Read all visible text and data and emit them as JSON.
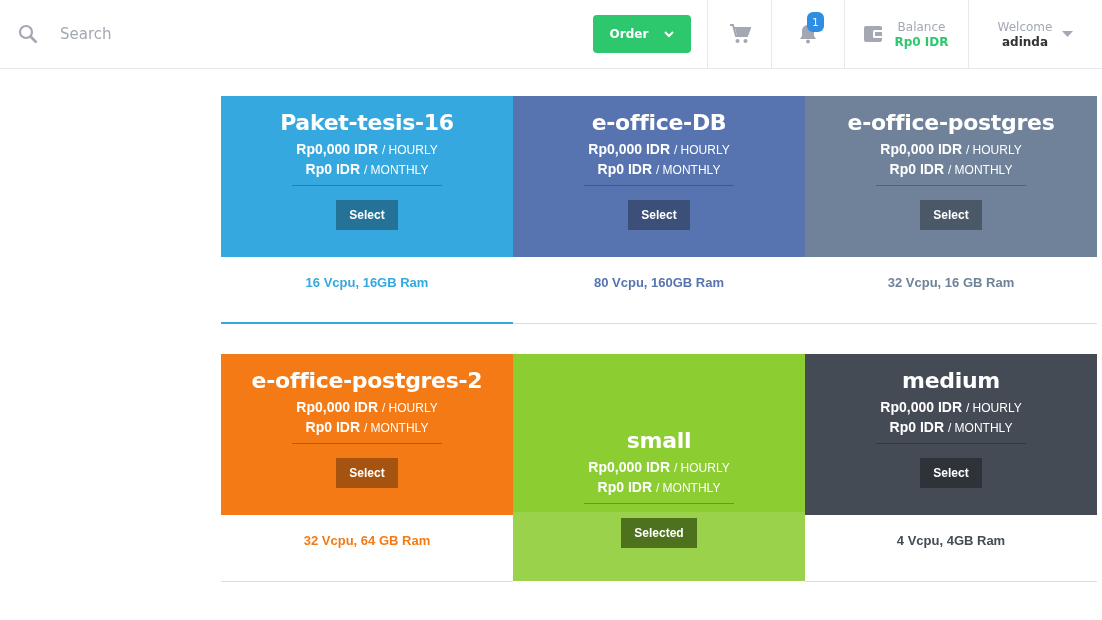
{
  "header": {
    "search": {
      "placeholder": "Search"
    },
    "order_button": "Order",
    "notifications": {
      "badge": "1"
    },
    "balance": {
      "label": "Balance",
      "value": "Rp0 IDR"
    },
    "user": {
      "label": "Welcome",
      "name": "adinda"
    }
  },
  "plans": [
    {
      "name": "Paket-tesis-16",
      "hourly": "Rp0,000 IDR",
      "hourly_unit": "/ HOURLY",
      "monthly": "Rp0 IDR",
      "monthly_unit": "/ MONTHLY",
      "button": "Select",
      "spec": "16 Vcpu, 16GB Ram",
      "color": "#35a8df",
      "selected": false,
      "highlighted": true
    },
    {
      "name": "e-office-DB",
      "hourly": "Rp0,000 IDR",
      "hourly_unit": "/ HOURLY",
      "monthly": "Rp0 IDR",
      "monthly_unit": "/ MONTHLY",
      "button": "Select",
      "spec": "80 Vcpu, 160GB Ram",
      "color": "#5774b0",
      "selected": false,
      "highlighted": false
    },
    {
      "name": "e-office-postgres",
      "hourly": "Rp0,000 IDR",
      "hourly_unit": "/ HOURLY",
      "monthly": "Rp0 IDR",
      "monthly_unit": "/ MONTHLY",
      "button": "Select",
      "spec": "32 Vcpu, 16 GB Ram",
      "color": "#6f8299",
      "selected": false,
      "highlighted": false
    },
    {
      "name": "e-office-postgres-2",
      "hourly": "Rp0,000 IDR",
      "hourly_unit": "/ HOURLY",
      "monthly": "Rp0 IDR",
      "monthly_unit": "/ MONTHLY",
      "button": "Select",
      "spec": "32 Vcpu, 64 GB Ram",
      "color": "#f37a14",
      "selected": false,
      "highlighted": false
    },
    {
      "name": "small",
      "hourly": "Rp0,000 IDR",
      "hourly_unit": "/ HOURLY",
      "monthly": "Rp0 IDR",
      "monthly_unit": "/ MONTHLY",
      "button": "Selected",
      "color": "#8ccd32",
      "selected": true,
      "highlighted": false
    },
    {
      "name": "medium",
      "hourly": "Rp0,000 IDR",
      "hourly_unit": "/ HOURLY",
      "monthly": "Rp0 IDR",
      "monthly_unit": "/ MONTHLY",
      "button": "Select",
      "spec": "4 Vcpu, 4GB Ram",
      "color": "#444b55",
      "selected": false,
      "highlighted": false
    }
  ]
}
